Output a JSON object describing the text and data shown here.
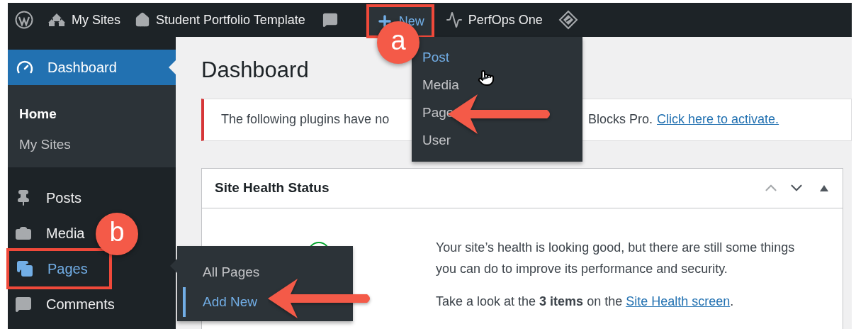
{
  "toolbar": {
    "items": [
      {
        "kind": "logo",
        "highlighted": false,
        "framed": false
      },
      {
        "kind": "sites",
        "label": "My Sites",
        "highlighted": false,
        "framed": false
      },
      {
        "kind": "home",
        "label": "Student Portfolio Template",
        "highlighted": false,
        "framed": false
      },
      {
        "kind": "comments",
        "highlighted": false,
        "framed": false
      },
      {
        "kind": "new",
        "label": "New",
        "highlighted": true,
        "framed": true
      },
      {
        "kind": "pulse",
        "label": "PerfOps One",
        "highlighted": false,
        "framed": false
      },
      {
        "kind": "diamond",
        "highlighted": false,
        "framed": false
      }
    ]
  },
  "new_menu": {
    "items": [
      {
        "label": "Post",
        "selected": true
      },
      {
        "label": "Media",
        "selected": false
      },
      {
        "label": "Page",
        "selected": false
      },
      {
        "label": "User",
        "selected": false
      }
    ]
  },
  "sidebar": {
    "items": [
      {
        "kind": "dashboard",
        "label": "Dashboard",
        "selected": true,
        "hovered": false,
        "framed": false,
        "children": [
          {
            "label": "Home",
            "selected": true
          },
          {
            "label": "My Sites",
            "selected": false
          }
        ]
      },
      {
        "kind": "posts",
        "label": "Posts",
        "selected": false,
        "hovered": false,
        "framed": false
      },
      {
        "kind": "media",
        "label": "Media",
        "selected": false,
        "hovered": false,
        "framed": false
      },
      {
        "kind": "pages",
        "label": "Pages",
        "selected": false,
        "hovered": true,
        "framed": true
      },
      {
        "kind": "comments",
        "label": "Comments",
        "selected": false,
        "hovered": false,
        "framed": false
      }
    ]
  },
  "flyout": {
    "items": [
      {
        "label": "All Pages",
        "selected": false
      },
      {
        "label": "Add New",
        "selected": true
      }
    ]
  },
  "page": {
    "title": "Dashboard",
    "notice": {
      "text_start": "The following plugins have no",
      "text_end": "Blocks Pro.",
      "link": "Click here to activate."
    },
    "site_health": {
      "title": "Site Health Status",
      "message": "Your site’s health is looking good, but there are still some things you can do to improve its performance and security.",
      "summary": "Take a look at the **3 items** on the ",
      "link": "Site Health screen",
      "summary_end": "."
    }
  },
  "callouts": [
    {
      "label": "a"
    },
    {
      "label": "b"
    }
  ]
}
